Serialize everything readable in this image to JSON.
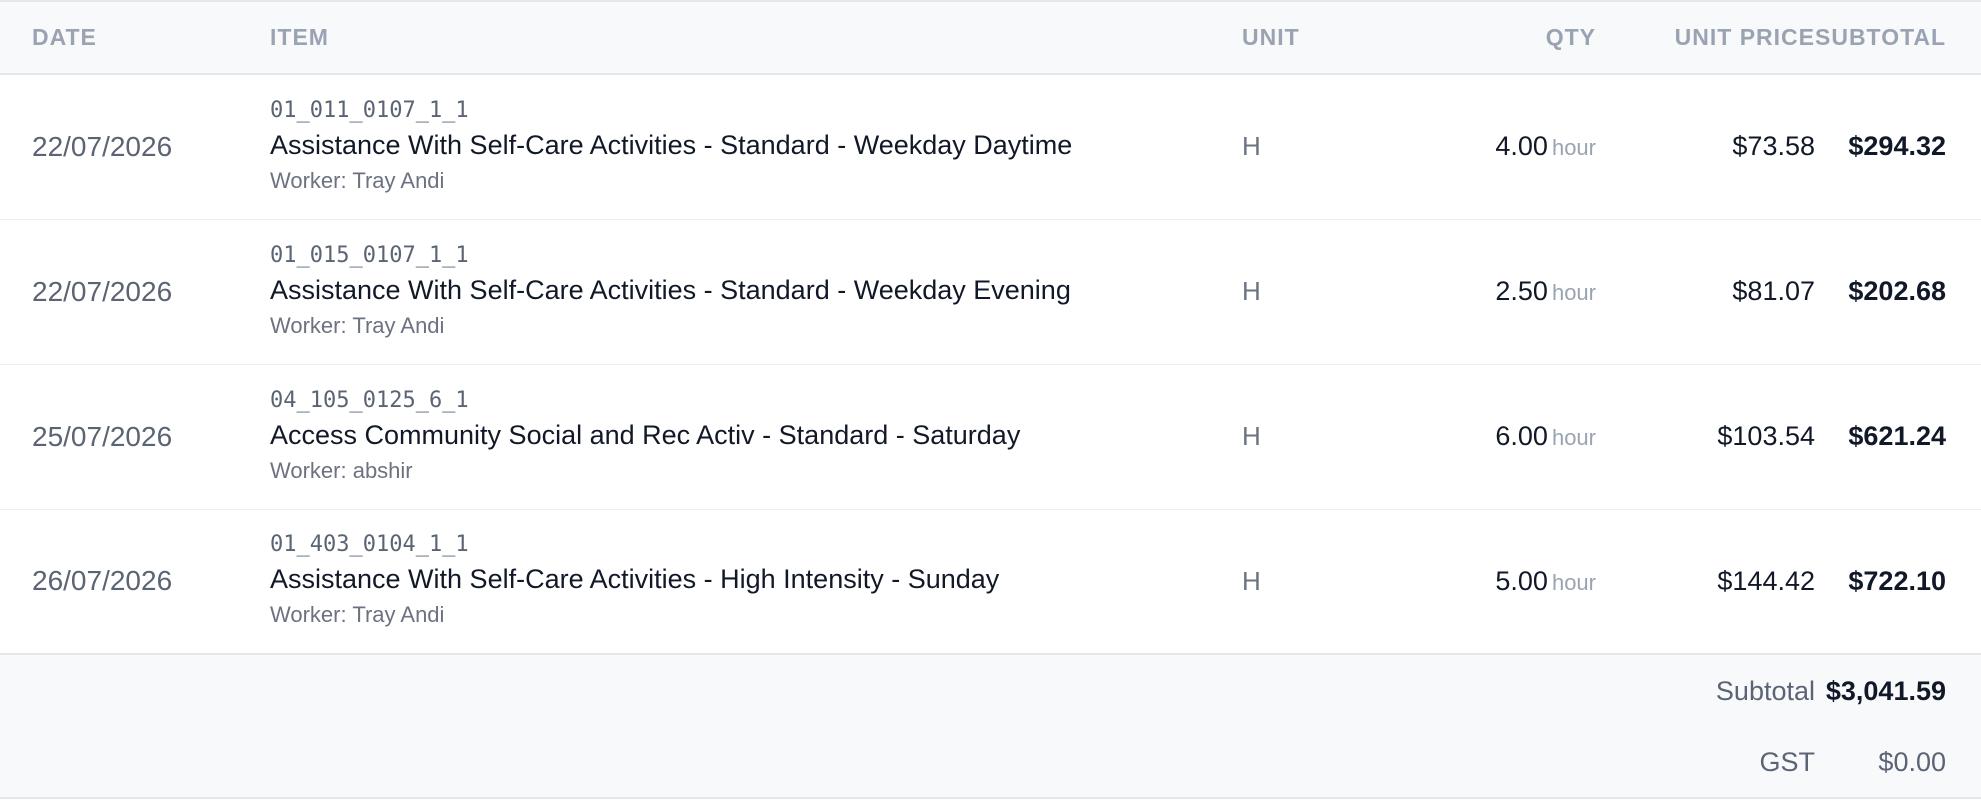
{
  "header": {
    "date": "DATE",
    "item": "ITEM",
    "unit": "UNIT",
    "qty": "QTY",
    "unit_price": "UNIT PRICE",
    "subtotal": "SUBTOTAL"
  },
  "rows": [
    {
      "date": "22/07/2026",
      "code": "01_011_0107_1_1",
      "description": "Assistance With Self-Care Activities - Standard - Weekday Daytime",
      "worker": "Worker: Tray Andi",
      "unit": "H",
      "qty": "4.00",
      "qty_unit": "hour",
      "unit_price": "$73.58",
      "subtotal": "$294.32"
    },
    {
      "date": "22/07/2026",
      "code": "01_015_0107_1_1",
      "description": "Assistance With Self-Care Activities - Standard - Weekday Evening",
      "worker": "Worker: Tray Andi",
      "unit": "H",
      "qty": "2.50",
      "qty_unit": "hour",
      "unit_price": "$81.07",
      "subtotal": "$202.68"
    },
    {
      "date": "25/07/2026",
      "code": "04_105_0125_6_1",
      "description": "Access Community Social and Rec Activ - Standard - Saturday",
      "worker": "Worker: abshir",
      "unit": "H",
      "qty": "6.00",
      "qty_unit": "hour",
      "unit_price": "$103.54",
      "subtotal": "$621.24"
    },
    {
      "date": "26/07/2026",
      "code": "01_403_0104_1_1",
      "description": "Assistance With Self-Care Activities - High Intensity - Sunday",
      "worker": "Worker: Tray Andi",
      "unit": "H",
      "qty": "5.00",
      "qty_unit": "hour",
      "unit_price": "$144.42",
      "subtotal": "$722.10"
    }
  ],
  "totals": {
    "subtotal_label": "Subtotal",
    "subtotal_value": "$3,041.59",
    "gst_label": "GST",
    "gst_value": "$0.00"
  }
}
